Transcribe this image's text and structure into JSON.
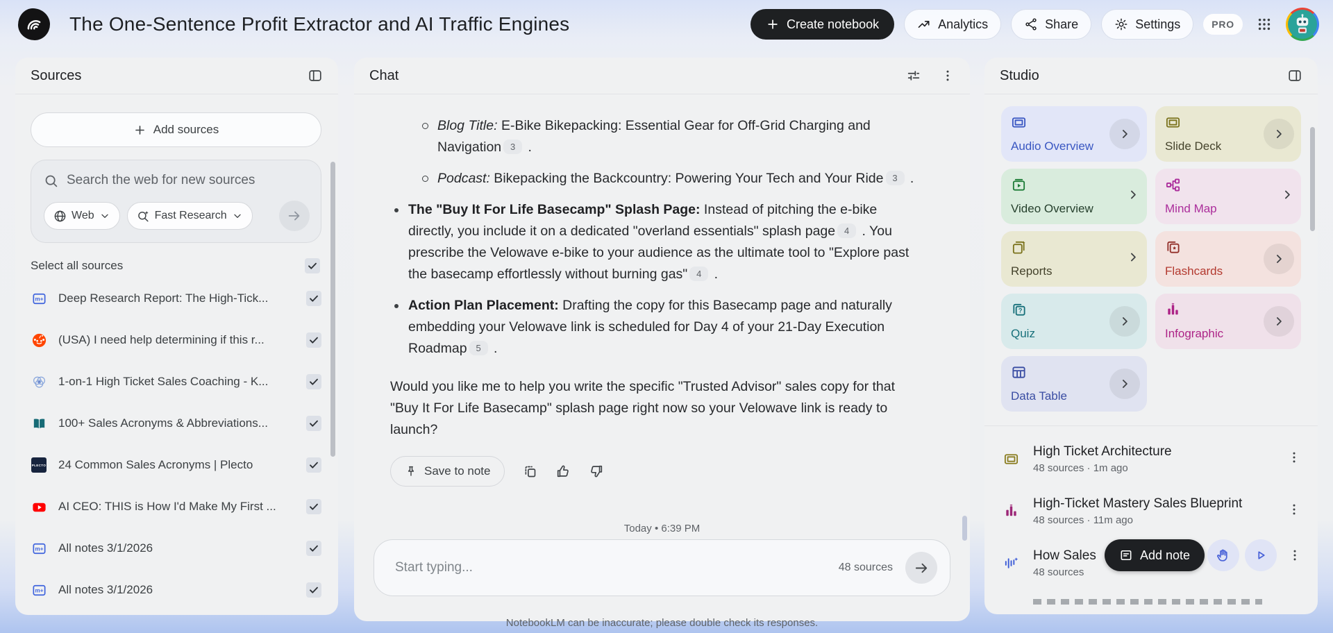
{
  "header": {
    "title": "The One-Sentence Profit Extractor and AI Traffic Engines",
    "create_notebook": "Create notebook",
    "analytics": "Analytics",
    "share": "Share",
    "settings": "Settings",
    "pro_badge": "PRO"
  },
  "sources": {
    "title": "Sources",
    "add_button": "Add sources",
    "search_placeholder": "Search the web for new sources",
    "web_chip": "Web",
    "research_chip": "Fast Research",
    "select_all": "Select all sources",
    "items": [
      {
        "icon": "nlm-note",
        "title": "Deep Research Report: The High-Tick...",
        "checked": true
      },
      {
        "icon": "reddit",
        "title": "(USA) I need help determining if this r...",
        "checked": true
      },
      {
        "icon": "venn",
        "title": "1-on-1 High Ticket Sales Coaching - K...",
        "checked": true
      },
      {
        "icon": "book",
        "title": "100+ Sales Acronyms & Abbreviations...",
        "checked": true
      },
      {
        "icon": "plecto",
        "title": "24 Common Sales Acronyms | Plecto",
        "checked": true
      },
      {
        "icon": "youtube",
        "title": "AI CEO: THIS is How I'd Make My First ...",
        "checked": true
      },
      {
        "icon": "nlm-note",
        "title": "All notes 3/1/2026",
        "checked": true
      },
      {
        "icon": "nlm-note",
        "title": "All notes 3/1/2026",
        "checked": true
      }
    ]
  },
  "chat": {
    "title": "Chat",
    "blocks": [
      {
        "type": "subbullet",
        "segments": [
          {
            "style": "italic",
            "text": "Blog Title:"
          },
          {
            "style": "normal",
            "text": " E-Bike Bikepacking: Essential Gear for Off-Grid Charging and Navigation"
          },
          {
            "style": "cite",
            "text": "3"
          },
          {
            "style": "normal",
            "text": " ."
          }
        ]
      },
      {
        "type": "subbullet",
        "segments": [
          {
            "style": "italic",
            "text": "Podcast:"
          },
          {
            "style": "normal",
            "text": " Bikepacking the Backcountry: Powering Your Tech and Your Ride"
          },
          {
            "style": "cite",
            "text": "3"
          },
          {
            "style": "normal",
            "text": " ."
          }
        ]
      },
      {
        "type": "bullet",
        "segments": [
          {
            "style": "bold",
            "text": "The \"Buy It For Life Basecamp\" Splash Page:"
          },
          {
            "style": "normal",
            "text": " Instead of pitching the e-bike directly, you include it on a dedicated \"overland essentials\" splash page"
          },
          {
            "style": "cite",
            "text": "4"
          },
          {
            "style": "normal",
            "text": " . You prescribe the Velowave e-bike to your audience as the ultimate tool to \"Explore past the basecamp effortlessly without burning gas\""
          },
          {
            "style": "cite",
            "text": "4"
          },
          {
            "style": "normal",
            "text": " ."
          }
        ]
      },
      {
        "type": "bullet",
        "segments": [
          {
            "style": "bold",
            "text": "Action Plan Placement:"
          },
          {
            "style": "normal",
            "text": " Drafting the copy for this Basecamp page and naturally embedding your Velowave link is scheduled for Day 4 of your 21-Day Execution Roadmap"
          },
          {
            "style": "cite",
            "text": "5"
          },
          {
            "style": "normal",
            "text": " ."
          }
        ]
      },
      {
        "type": "paragraph",
        "segments": [
          {
            "style": "normal",
            "text": "Would you like me to help you write the specific \"Trusted Advisor\" sales copy for that \"Buy It For Life Basecamp\" splash page right now so your Velowave link is ready to launch?"
          }
        ]
      }
    ],
    "save_to_note": "Save to note",
    "timestamp": "Today • 6:39 PM",
    "input_placeholder": "Start typing...",
    "source_count": "48 sources",
    "disclaimer": "NotebookLM can be inaccurate; please double check its responses."
  },
  "studio": {
    "title": "Studio",
    "cards": [
      {
        "id": "audio-overview",
        "label": "Audio Overview",
        "bg": "#e2e6f8",
        "icon_color": "#3a57c2",
        "label_color": "#3a57c2",
        "chevron": "circle"
      },
      {
        "id": "slide-deck",
        "label": "Slide Deck",
        "bg": "#e9e8d2",
        "icon_color": "#7b731d",
        "label_color": "#45432c",
        "chevron": "circle"
      },
      {
        "id": "video-overview",
        "label": "Video Overview",
        "bg": "#d9ecdd",
        "icon_color": "#1d7c37",
        "label_color": "#26402d",
        "chevron": "plain"
      },
      {
        "id": "mind-map",
        "label": "Mind Map",
        "bg": "#f1e3ed",
        "icon_color": "#ab2d9b",
        "label_color": "#ab2d9b",
        "chevron": "plain"
      },
      {
        "id": "reports",
        "label": "Reports",
        "bg": "#e9e8d2",
        "icon_color": "#7b731d",
        "label_color": "#45432c",
        "chevron": "plain"
      },
      {
        "id": "flashcards",
        "label": "Flashcards",
        "bg": "#f4e2df",
        "icon_color": "#93302a",
        "label_color": "#b3392f",
        "chevron": "circle"
      },
      {
        "id": "quiz",
        "label": "Quiz",
        "bg": "#d8eaeb",
        "icon_color": "#17707a",
        "label_color": "#17707a",
        "chevron": "circle"
      },
      {
        "id": "infographic",
        "label": "Infographic",
        "bg": "#f0e1ea",
        "icon_color": "#ad2487",
        "label_color": "#ad2487",
        "chevron": "circle"
      },
      {
        "id": "data-table",
        "label": "Data Table",
        "bg": "#e0e3f1",
        "icon_color": "#3a4da3",
        "label_color": "#3a4da3",
        "chevron": "circle"
      }
    ],
    "items": [
      {
        "icon": "slide-deck",
        "icon_color": "#8a7d20",
        "title": "High Ticket Architecture",
        "meta": "48 sources · 1m ago"
      },
      {
        "icon": "infographic",
        "icon_color": "#9c2777",
        "title": "High-Ticket Mastery Sales Blueprint",
        "meta": "48 sources · 11m ago"
      },
      {
        "icon": "audio-waveform",
        "icon_color": "#3b5bd7",
        "title": "How Sales",
        "meta": "48 sources"
      }
    ],
    "add_note": "Add note"
  }
}
